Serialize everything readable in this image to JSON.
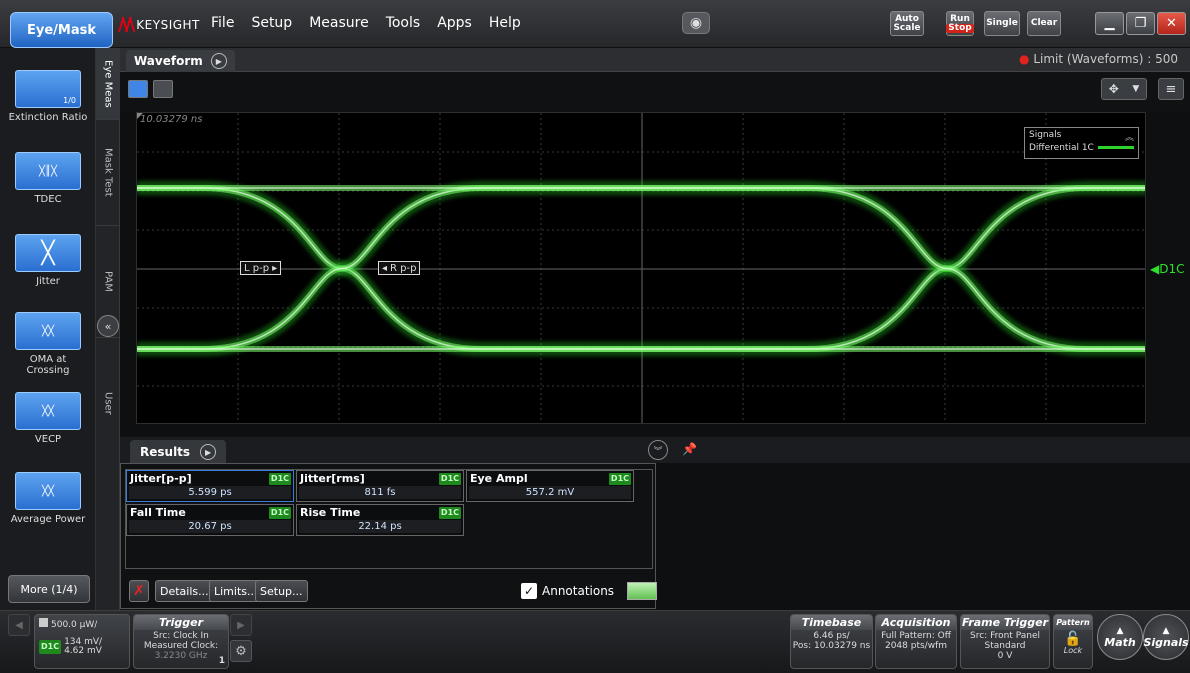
{
  "app": {
    "mode_button": "Eye/Mask",
    "brand": "KEYSIGHT"
  },
  "menu": [
    "File",
    "Setup",
    "Measure",
    "Tools",
    "Apps",
    "Help"
  ],
  "toolbar": {
    "auto_scale": "Auto Scale",
    "run": "Run",
    "stop": "Stop",
    "single": "Single",
    "clear": "Clear"
  },
  "sidebar": {
    "items": [
      {
        "label": "Extinction Ratio",
        "icon_text": "1/0"
      },
      {
        "label": "TDEC"
      },
      {
        "label": "Jitter"
      },
      {
        "label": "OMA at Crossing"
      },
      {
        "label": "VECP"
      },
      {
        "label": "Average Power"
      }
    ],
    "more": "More (1/4)"
  },
  "vtabs": [
    "Eye Meas",
    "Mask Test",
    "PAM",
    "User"
  ],
  "waveform": {
    "tab": "Waveform",
    "limit": "Limit (Waveforms) : 500",
    "time_label": "10.03279 ns",
    "legend_title": "Signals",
    "legend_item": "Differential 1C",
    "marker_left": "L p-p",
    "marker_right": "R p-p",
    "channel_label": "D1C"
  },
  "results": {
    "tab": "Results",
    "cells": [
      {
        "name": "Jitter[p-p]",
        "badge": "D1C",
        "value": "5.599 ps"
      },
      {
        "name": "Jitter[rms]",
        "badge": "D1C",
        "value": "811 fs"
      },
      {
        "name": "Eye Ampl",
        "badge": "D1C",
        "value": "557.2 mV"
      },
      {
        "name": "Fall Time",
        "badge": "D1C",
        "value": "20.67 ps"
      },
      {
        "name": "Rise Time",
        "badge": "D1C",
        "value": "22.14 ps"
      }
    ],
    "details": "Details...",
    "limits": "Limits...",
    "setup": "Setup...",
    "annotations": "Annotations"
  },
  "bottom": {
    "ch_scale": "500.0 µW/",
    "ch_badge": "D1C",
    "ch_val1": "134 mV/",
    "ch_val2": "4.62 mV",
    "trigger": {
      "title": "Trigger",
      "l1": "Src: Clock In",
      "l2": "Measured Clock:",
      "l3": "3.2230 GHz",
      "num": "1"
    },
    "timebase": {
      "title": "Timebase",
      "l1": "6.46 ps/",
      "l2": "Pos: 10.03279 ns"
    },
    "acquisition": {
      "title": "Acquisition",
      "l1": "Full Pattern: Off",
      "l2": "2048 pts/wfm"
    },
    "frame_trigger": {
      "title": "Frame Trigger",
      "l1": "Src: Front Panel",
      "l2": "Standard",
      "l3": "0 V"
    },
    "pattern": "Pattern",
    "lock": "Lock",
    "math": "Math",
    "signals": "Signals"
  },
  "colors": {
    "accent": "#2f7be0",
    "trace": "#2cd42c",
    "limit_dot": "#e0231c"
  }
}
